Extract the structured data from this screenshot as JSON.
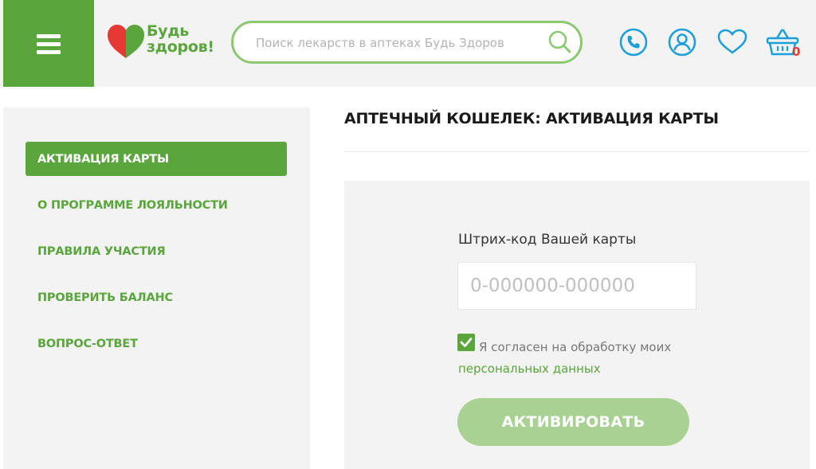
{
  "header": {
    "logo_line1": "Будь",
    "logo_line2": "здоров!",
    "search_placeholder": "Поиск лекарств в аптеках Будь Здоров",
    "cart_count": "0",
    "icons": [
      "menu-icon",
      "phone-icon",
      "user-icon",
      "heart-icon",
      "basket-icon",
      "search-icon"
    ]
  },
  "sidebar": {
    "items": [
      {
        "label": "АКТИВАЦИЯ КАРТЫ",
        "active": true
      },
      {
        "label": "О ПРОГРАММЕ ЛОЯЛЬНОСТИ",
        "active": false
      },
      {
        "label": "ПРАВИЛА УЧАСТИЯ",
        "active": false
      },
      {
        "label": "ПРОВЕРИТЬ БАЛАНС",
        "active": false
      },
      {
        "label": "ВОПРОС-ОТВЕТ",
        "active": false
      }
    ]
  },
  "main": {
    "title": "АПТЕЧНЫЙ КОШЕЛЕК: АКТИВАЦИЯ КАРТЫ",
    "form": {
      "barcode_label": "Штрих-код Вашей карты",
      "barcode_placeholder": "0-000000-000000",
      "barcode_value": "",
      "consent_text": "Я согласен на обработку моих",
      "consent_link": "персональных данных",
      "consent_checked": true,
      "submit_label": "АКТИВИРОВАТЬ"
    }
  },
  "colors": {
    "brand_green": "#5aa53c",
    "light_green": "#a9d193",
    "icon_blue": "#1a9fd9",
    "badge_red": "#e53935",
    "panel_gray": "#f3f3f3"
  }
}
